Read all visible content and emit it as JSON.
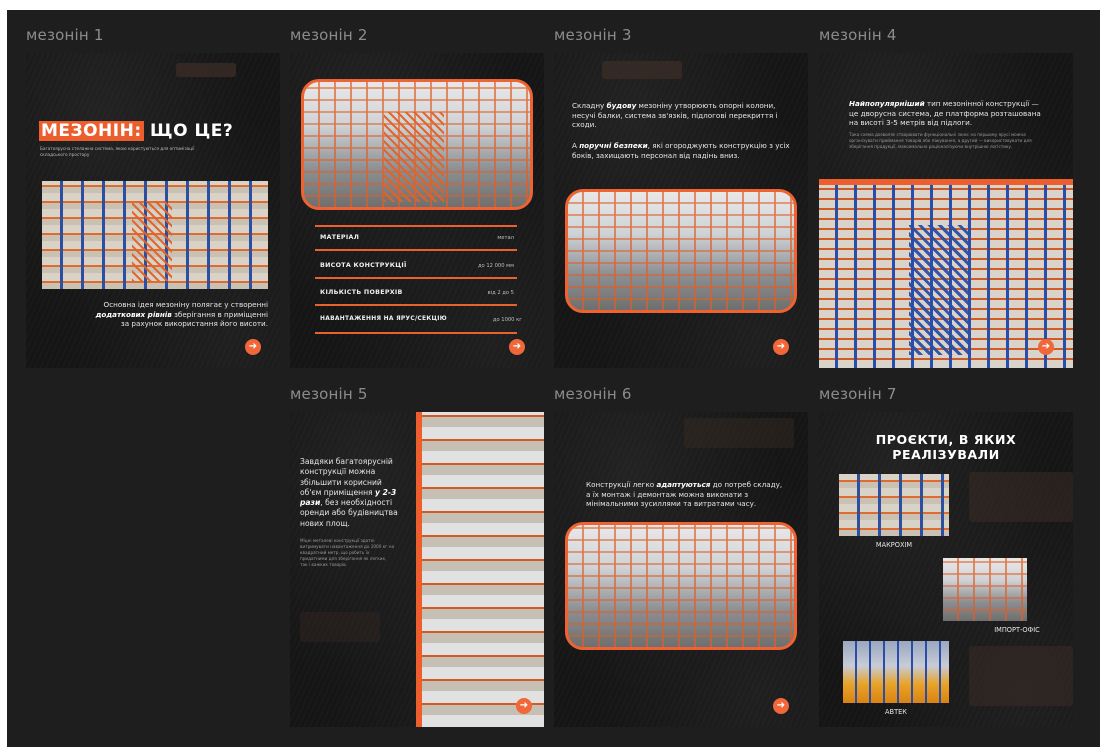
{
  "frames": {
    "f1": {
      "label": "мезонін 1",
      "title_highlight": "МЕЗОНІН:",
      "title_rest": " ЩО ЦЕ?",
      "subtitle": "Багатоярусна стелажна система, якою користуються для оптимізації складського простору",
      "body_a": "Основна ідея мезоніну полягає у створенні ",
      "body_em": "додаткових рівнів",
      "body_b": " зберігання в приміщенні за рахунок використання його висоти."
    },
    "f2": {
      "label": "мезонін 2",
      "props": [
        {
          "name": "МАТЕРІАЛ",
          "value": "метал"
        },
        {
          "name": "ВИСОТА КОНСТРУКЦІЇ",
          "value": "до 12 000 мм"
        },
        {
          "name": "КІЛЬКІСТЬ ПОВЕРХІВ",
          "value": "від 2 до 5"
        },
        {
          "name": "НАВАНТАЖЕННЯ НА ЯРУС/СЕКЦІЮ",
          "value": "до 1000 кг"
        }
      ]
    },
    "f3": {
      "label": "мезонін 3",
      "p1_a": "Складну ",
      "p1_em": "будову",
      "p1_b": " мезоніну утворюють опорні колони, несучі балки, система зв'язків, підлогові перекриття і сходи.",
      "p2_a": "А ",
      "p2_em": "поручні безпеки",
      "p2_b": ", які огороджують конструкцію з усіх боків, захищають персонал від падінь вниз."
    },
    "f4": {
      "label": "мезонін 4",
      "p1_em": "Найпопулярніший",
      "p1_b": " тип мезонінної конструкції — це дворусна система, де платформа розташована на висоті 3-5 метрів від підлоги.",
      "small": "Така схема дозволяє створювати функціональні зони: на першому ярусі можна організувати приймання товарів або пакування, а другий — використовувати для зберігання продукції, максимально раціоналізуючи внутрішню логістику."
    },
    "f5": {
      "label": "мезонін 5",
      "p1_a": "Завдяки багатоярусній конструкції можна збільшити корисний об'єм приміщення ",
      "p1_em": "у 2-3 рази",
      "p1_b": ", без необхідності оренди або будівництва нових площ.",
      "small": "Міцні металеві конструкції здатні витримувати навантаження до 1000 кг на квадратний метр, що робить їх придатними для зберігання як легких, так і важких товарів."
    },
    "f6": {
      "label": "мезонін 6",
      "p1_a": "Конструкції легко ",
      "p1_em": "адаптуються",
      "p1_b": " до потреб складу, а їх монтаж і демонтаж можна виконати з мінімальними зусиллями та витратами часу."
    },
    "f7": {
      "label": "мезонін 7",
      "title": "ПРОЄКТИ, В ЯКИХ РЕАЛІЗУВАЛИ",
      "projects": [
        "МАКРОХІМ",
        "ІМПОРТ-ОФІС",
        "АВТЕК"
      ]
    }
  },
  "arrow_glyph": "➔",
  "colors": {
    "accent": "#f0673a",
    "background": "#1e1e1e",
    "frame": "#151515"
  }
}
